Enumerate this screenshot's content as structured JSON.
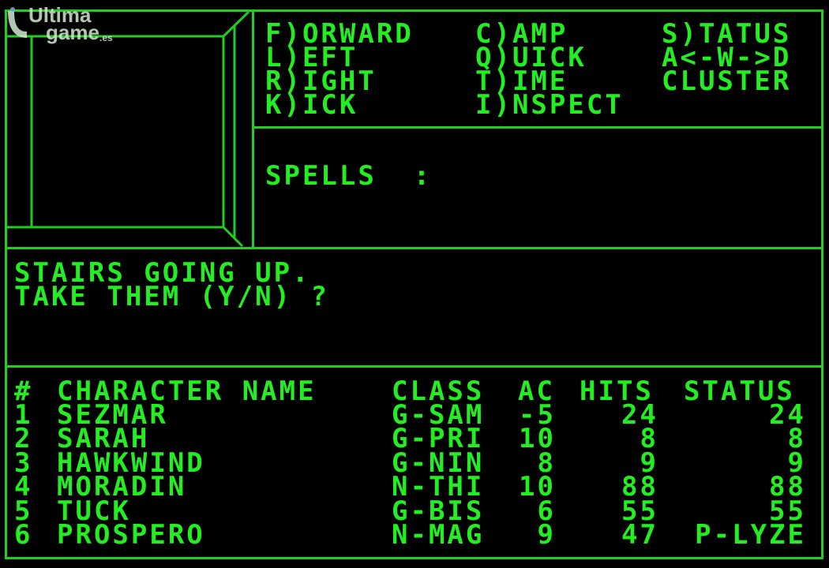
{
  "watermark": {
    "line1": "Ultima",
    "line2": "game",
    "suffix": ".es"
  },
  "commands": {
    "col1": [
      "F)ORWARD",
      "L)EFT",
      "R)IGHT",
      "K)ICK"
    ],
    "col2": [
      "C)AMP",
      "Q)UICK",
      "T)IME",
      "I)NSPECT"
    ],
    "col3": [
      "S)TATUS",
      "A<-W->D",
      "CLUSTER"
    ]
  },
  "spells": {
    "label": "SPELLS  :"
  },
  "message": {
    "line1": "STAIRS GOING UP.",
    "line2": "TAKE THEM (Y/N) ?"
  },
  "party": {
    "header": {
      "num": "#",
      "name": "CHARACTER NAME",
      "class": "CLASS",
      "ac": "AC",
      "hits": "HITS",
      "status": "STATUS"
    },
    "rows": [
      {
        "num": "1",
        "name": "SEZMAR",
        "class": "G-SAM",
        "ac": "-5",
        "hits": "24",
        "status": "24"
      },
      {
        "num": "2",
        "name": "SARAH",
        "class": "G-PRI",
        "ac": "10",
        "hits": "8",
        "status": "8"
      },
      {
        "num": "3",
        "name": "HAWKWIND",
        "class": "G-NIN",
        "ac": "8",
        "hits": "9",
        "status": "9"
      },
      {
        "num": "4",
        "name": "MORADIN",
        "class": "N-THI",
        "ac": "10",
        "hits": "88",
        "status": "88"
      },
      {
        "num": "5",
        "name": "TUCK",
        "class": "G-BIS",
        "ac": "6",
        "hits": "55",
        "status": "55"
      },
      {
        "num": "6",
        "name": "PROSPERO",
        "class": "N-MAG",
        "ac": "9",
        "hits": "47",
        "status": "P-LYZE"
      }
    ]
  },
  "colors": {
    "phosphor": "#22ee22",
    "border": "#22cc22",
    "background": "#000000"
  }
}
